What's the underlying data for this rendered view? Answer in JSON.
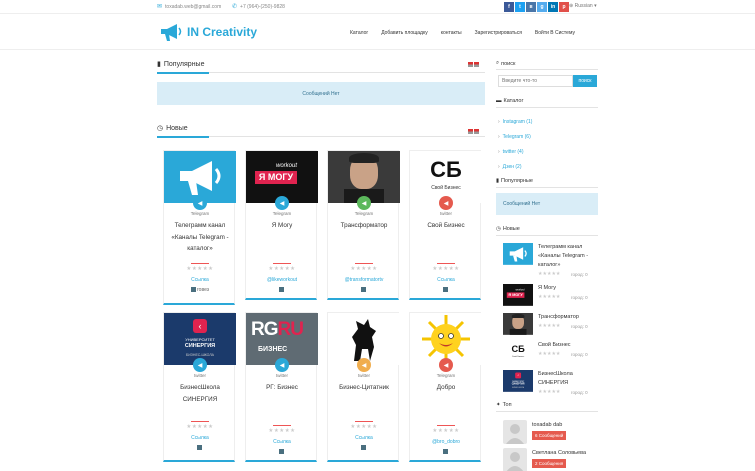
{
  "topbar": {
    "email": "toxadab.web@gmail.com",
    "phone": "+7 (964)-(250)-9828",
    "language": "Russian",
    "social": [
      {
        "name": "facebook-icon",
        "glyph": "f",
        "color": "#3b5998"
      },
      {
        "name": "twitter-icon",
        "glyph": "t",
        "color": "#1da1f2"
      },
      {
        "name": "vk-icon",
        "glyph": "в",
        "color": "#4a76a8"
      },
      {
        "name": "google-plus-icon",
        "glyph": "g",
        "color": "#55acee"
      },
      {
        "name": "linkedin-icon",
        "glyph": "in",
        "color": "#0077b5"
      },
      {
        "name": "pinterest-icon",
        "glyph": "p",
        "color": "#e1504a"
      }
    ]
  },
  "header": {
    "logo_text": "IN Creativity",
    "nav": [
      "Каталог",
      "Добавить площадку",
      "контакты",
      "Зарегистрироваться",
      "Войти В Систему"
    ]
  },
  "main": {
    "popular_title": "Популярные",
    "popular_empty": "Сообщений Нет",
    "new_title": "Новые",
    "cards": [
      {
        "platform": "Telegram",
        "title": "Телеграмм канал «Каналы Telegram - каталог»",
        "link": "Ссылка",
        "footer": "говез",
        "badge_color": "#2aa8d8"
      },
      {
        "platform": "Telegram",
        "title": "Я Могу",
        "link": "@likeworkout",
        "footer": "",
        "badge_color": "#2aa8d8"
      },
      {
        "platform": "Telegram",
        "title": "Трансформатор",
        "link": "@transformatortv",
        "footer": "",
        "badge_color": "#5cb85c"
      },
      {
        "platform": "twitter",
        "title": "Свой Бизнес",
        "link": "Ссылка",
        "footer": "",
        "badge_color": "#e55a4e"
      },
      {
        "platform": "twitter",
        "title": "БизнесШкола СИНЕРГИЯ",
        "link": "Ссылка",
        "footer": "",
        "badge_color": "#2aa8d8"
      },
      {
        "platform": "twitter",
        "title": "РГ: Бизнес",
        "link": "Ссылка",
        "footer": "",
        "badge_color": "#2aa8d8"
      },
      {
        "platform": "twitter",
        "title": "Бизнес-Цитатник",
        "link": "Ссылка",
        "footer": "",
        "badge_color": "#f0ad4e"
      },
      {
        "platform": "Telegram",
        "title": "Добро",
        "link": "@bro_dobro",
        "footer": "",
        "badge_color": "#e55a4e"
      }
    ]
  },
  "sidebar": {
    "search_title": "поиск",
    "search_placeholder": "Введите что-то",
    "search_button": "поиск",
    "catalog_title": "Каталог",
    "catalog_items": [
      "Instagram (1)",
      "Telegram (6)",
      "twitter (4)",
      "Дзен (2)"
    ],
    "popular_title": "Популярные",
    "popular_empty": "Сообщений Нет",
    "new_title": "Новые",
    "new_items": [
      {
        "title": "Телеграмм канал «Каналы Telegram - каталог»",
        "city": "город: 0"
      },
      {
        "title": "Я Могу",
        "city": "город: 0"
      },
      {
        "title": "Трансформатор",
        "city": "город: 0"
      },
      {
        "title": "Свой Бизнес",
        "city": "город: 0"
      },
      {
        "title": "БизнесШкола СИНЕРГИЯ",
        "city": "город: 0"
      }
    ],
    "top_title": "Топ",
    "top_users": [
      {
        "name": "toxadab dab",
        "badge": "6 Сообщений"
      },
      {
        "name": "Светлана Соловьева",
        "badge": "2 Сообщения"
      }
    ]
  },
  "thumbs": {
    "ya_mogu_small": "workout",
    "ya_mogu_big": "Я МОГУ",
    "sb_big": "СБ",
    "sb_small": "Свой Бизнес",
    "synergy_1": "УНИВЕРСИТЕТ",
    "synergy_2": "СИНЕРГИЯ",
    "synergy_3": "БИЗНЕС-ШКОЛА",
    "rg_1": "RG",
    "rg_2": "RU",
    "rg_3": "БИЗНЕС"
  },
  "stars": "★★★★★"
}
